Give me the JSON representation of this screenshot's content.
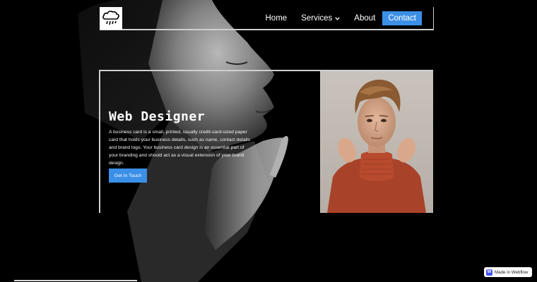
{
  "nav": {
    "logo_icon": "rain-cloud-icon",
    "items": [
      {
        "label": "Home"
      },
      {
        "label": "Services"
      },
      {
        "label": "About"
      }
    ],
    "services_icon": "chevron-down-icon",
    "contact_label": "Contact",
    "accent": "#3b8fe6"
  },
  "hero": {
    "title": "Web Designer",
    "description": "A business card is a small, printed, usually credit-card-sized paper card that holds your business details, such as name, contact details and brand logo. Your business card design is an essential part of your branding and should act as a visual extension of your brand design.",
    "cta_label": "Get In Touch"
  },
  "badge": {
    "icon_letter": "W",
    "label": "Made in Webflow"
  }
}
